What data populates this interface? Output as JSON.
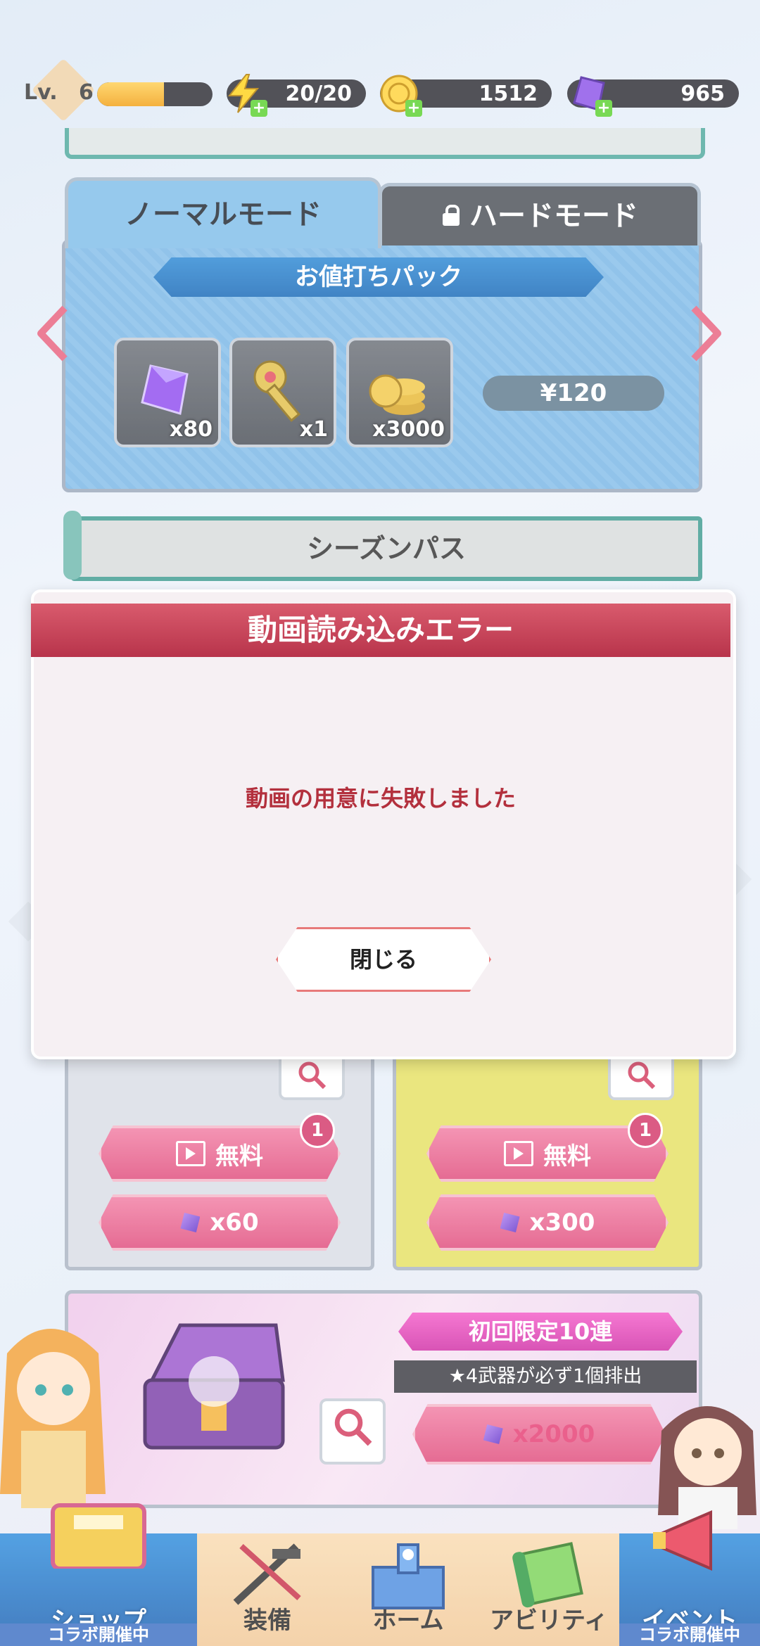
{
  "status": {
    "level_label": "Lv.",
    "level": "6",
    "level_progress": 0.58,
    "stamina": "20/20",
    "coins": "1512",
    "gems": "965"
  },
  "modes": {
    "normal_tab": "ノーマルモード",
    "hard_tab": "ハードモード"
  },
  "pack": {
    "title": "お値打ちパック",
    "items": [
      {
        "icon": "gem-icon",
        "count": "x80"
      },
      {
        "icon": "key-icon",
        "count": "x1"
      },
      {
        "icon": "coin-stack-icon",
        "count": "x3000"
      }
    ],
    "price": "¥120"
  },
  "season_pass": "シーズンパス",
  "gacha": {
    "free_label": "無料",
    "badge": "1",
    "left_gem_cost": "x60",
    "right_gem_cost": "x300",
    "first_limited": "初回限定10連",
    "guarantee": "★4武器が必ず1個排出",
    "bottom_gem_cost": "x2000"
  },
  "modal": {
    "title": "動画読み込みエラー",
    "message": "動画の用意に失敗しました",
    "close_label": "閉じる"
  },
  "nav": [
    {
      "label": "ショップ",
      "sub": "コラボ開催中",
      "icon": "shop-chest-icon"
    },
    {
      "label": "装備",
      "icon": "weapons-icon"
    },
    {
      "label": "ホーム",
      "icon": "school-building-icon"
    },
    {
      "label": "アビリティ",
      "icon": "scroll-icon"
    },
    {
      "label": "イベント",
      "sub": "コラボ開催中",
      "icon": "megaphone-icon"
    }
  ],
  "colors": {
    "accent_red": "#b8344b",
    "accent_pink": "#e04c7c",
    "nav_active_blue": "#1a5fb0",
    "panel_blue": "#79b6e6"
  }
}
